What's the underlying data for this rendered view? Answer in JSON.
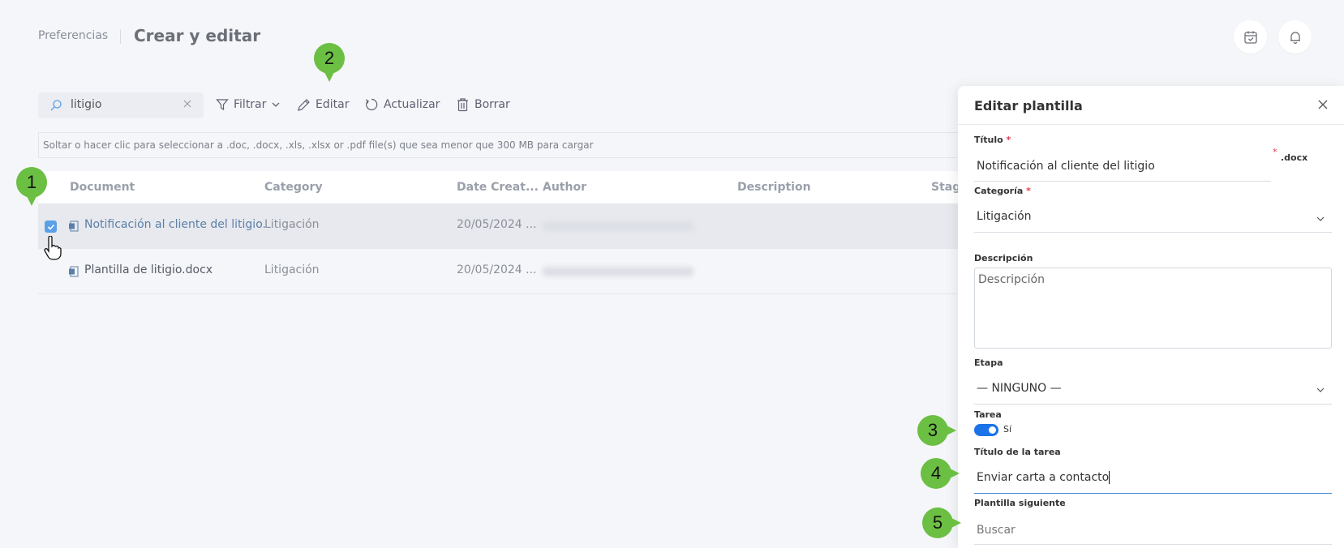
{
  "breadcrumb": {
    "parent": "Preferencias",
    "current": "Crear y editar"
  },
  "header_icons": {
    "calendar": "calendar-check-icon",
    "bell": "bell-icon"
  },
  "toolbar": {
    "search_value": "litigio",
    "filter": "Filtrar",
    "edit": "Editar",
    "refresh": "Actualizar",
    "delete": "Borrar"
  },
  "dropzone_text": "Soltar o hacer clic para seleccionar a .doc, .docx, .xls, .xlsx or .pdf file(s) que sea menor que 300 MB para cargar",
  "table": {
    "columns": [
      "Document",
      "Category",
      "Date Creat...",
      "Author",
      "Description",
      "Stag"
    ],
    "rows": [
      {
        "document": "Notificación al cliente del litigio.",
        "category": "Litigación",
        "date": "20/05/2024 ...",
        "selected": true
      },
      {
        "document": "Plantilla de litigio.docx",
        "category": "Litigación",
        "date": "20/05/2024 ...",
        "selected": false
      }
    ]
  },
  "panel": {
    "title": "Editar plantilla",
    "title_label": "Título",
    "title_value": "Notificación al cliente del litigio",
    "extension": ".docx",
    "category_label": "Categoría",
    "category_value": "Litigación",
    "description_label": "Descripción",
    "description_placeholder": "Descripción",
    "stage_label": "Etapa",
    "stage_value": "— NINGUNO —",
    "task_label": "Tarea",
    "task_toggle_on": true,
    "task_toggle_text": "Sí",
    "task_title_label": "Título de la tarea",
    "task_title_value": "Enviar carta a contacto",
    "next_template_label": "Plantilla siguiente",
    "next_template_placeholder": "Buscar"
  },
  "markers": [
    "1",
    "2",
    "3",
    "4",
    "5"
  ],
  "colors": {
    "accent": "#1a73e8",
    "marker": "#6bbf43",
    "checkbox": "#5aa0e6"
  }
}
